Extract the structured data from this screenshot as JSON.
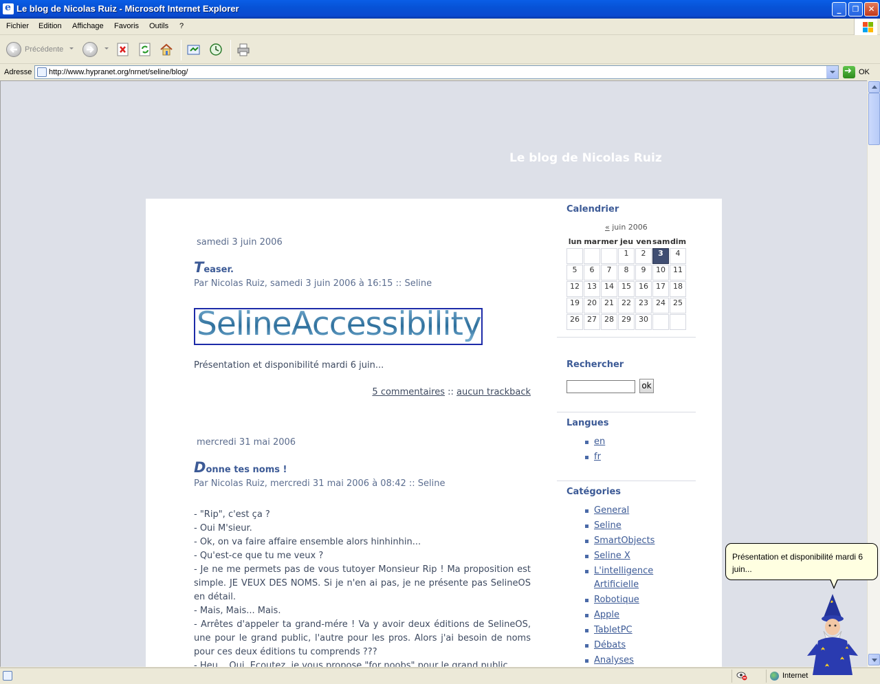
{
  "window": {
    "title": "Le blog de Nicolas Ruiz - Microsoft Internet Explorer",
    "minimize": "_",
    "maximize": "❐",
    "close": "✕"
  },
  "menu": [
    "Fichier",
    "Edition",
    "Affichage",
    "Favoris",
    "Outils",
    "?"
  ],
  "toolbar": {
    "back_label": "Précédente"
  },
  "address": {
    "label": "Adresse",
    "url": "http://www.hypranet.org/nrnet/seline/blog/",
    "go_label": "OK"
  },
  "blog": {
    "title": "Le blog de Nicolas Ruiz"
  },
  "posts": [
    {
      "date": "samedi 3 juin 2006",
      "title_cap": "T",
      "title_rest": "easer.",
      "meta": "Par Nicolas Ruiz, samedi 3 juin 2006 à 16:15 :: Seline",
      "logo_text": "SelineAccessibility",
      "excerpt": "Présentation et disponibilité mardi 6 juin...",
      "comments": "5 commentaires",
      "links_sep": "::",
      "trackback": "aucun trackback"
    },
    {
      "date": "mercredi 31 mai 2006",
      "title_cap": "D",
      "title_rest": "onne tes noms !",
      "meta": "Par Nicolas Ruiz, mercredi 31 mai 2006 à 08:42 :: Seline",
      "body": [
        "- \"Rip\", c'est ça ?",
        "- Oui M'sieur.",
        "- Ok, on va faire affaire ensemble alors hinhinhin...",
        "- Qu'est-ce que tu me veux ?",
        "- Je ne me permets pas de vous tutoyer Monsieur Rip ! Ma proposition est simple. JE VEUX DES NOMS. Si je n'en ai pas, je ne présente pas SelineOS en détail.",
        "- Mais, Mais... Mais.",
        "- Arrêtes d'appeler ta grand-mére ! Va y avoir deux éditions de SelineOS, une pour le grand public, l'autre pour les pros. Alors j'ai besoin de noms pour ces deux éditions tu comprends ???",
        "- Heu... Oui. Ecoutez, je vous propose \"for noobs\" pour le grand public"
      ]
    }
  ],
  "sidebar": {
    "calendar": {
      "heading": "Calendrier",
      "prev": "«",
      "month": "juin 2006",
      "dow": [
        "lun",
        "mar",
        "mer",
        "jeu",
        "ven",
        "sam",
        "dim"
      ],
      "weeks": [
        [
          "",
          "",
          "",
          "1",
          "2",
          "3",
          "4"
        ],
        [
          "5",
          "6",
          "7",
          "8",
          "9",
          "10",
          "11"
        ],
        [
          "12",
          "13",
          "14",
          "15",
          "16",
          "17",
          "18"
        ],
        [
          "19",
          "20",
          "21",
          "22",
          "23",
          "24",
          "25"
        ],
        [
          "26",
          "27",
          "28",
          "29",
          "30",
          "",
          ""
        ]
      ],
      "today": "3"
    },
    "search": {
      "heading": "Rechercher",
      "button": "ok",
      "value": ""
    },
    "languages": {
      "heading": "Langues",
      "items": [
        "en",
        "fr"
      ]
    },
    "categories": {
      "heading": "Catégories",
      "items": [
        "General",
        "Seline",
        "SmartObjects",
        "Seline X",
        "L'intelligence Artificielle",
        "Robotique",
        "Apple",
        "TabletPC",
        "Débats",
        "Analyses"
      ]
    }
  },
  "status": {
    "zone": "Internet"
  },
  "agent": {
    "balloon": "Présentation et disponibilité mardi 6 juin..."
  },
  "colors": {
    "titlebar": "#0a5ee6",
    "page_bg": "#dde0e8",
    "accent": "#3c5a96",
    "today_cell": "#404e72"
  }
}
